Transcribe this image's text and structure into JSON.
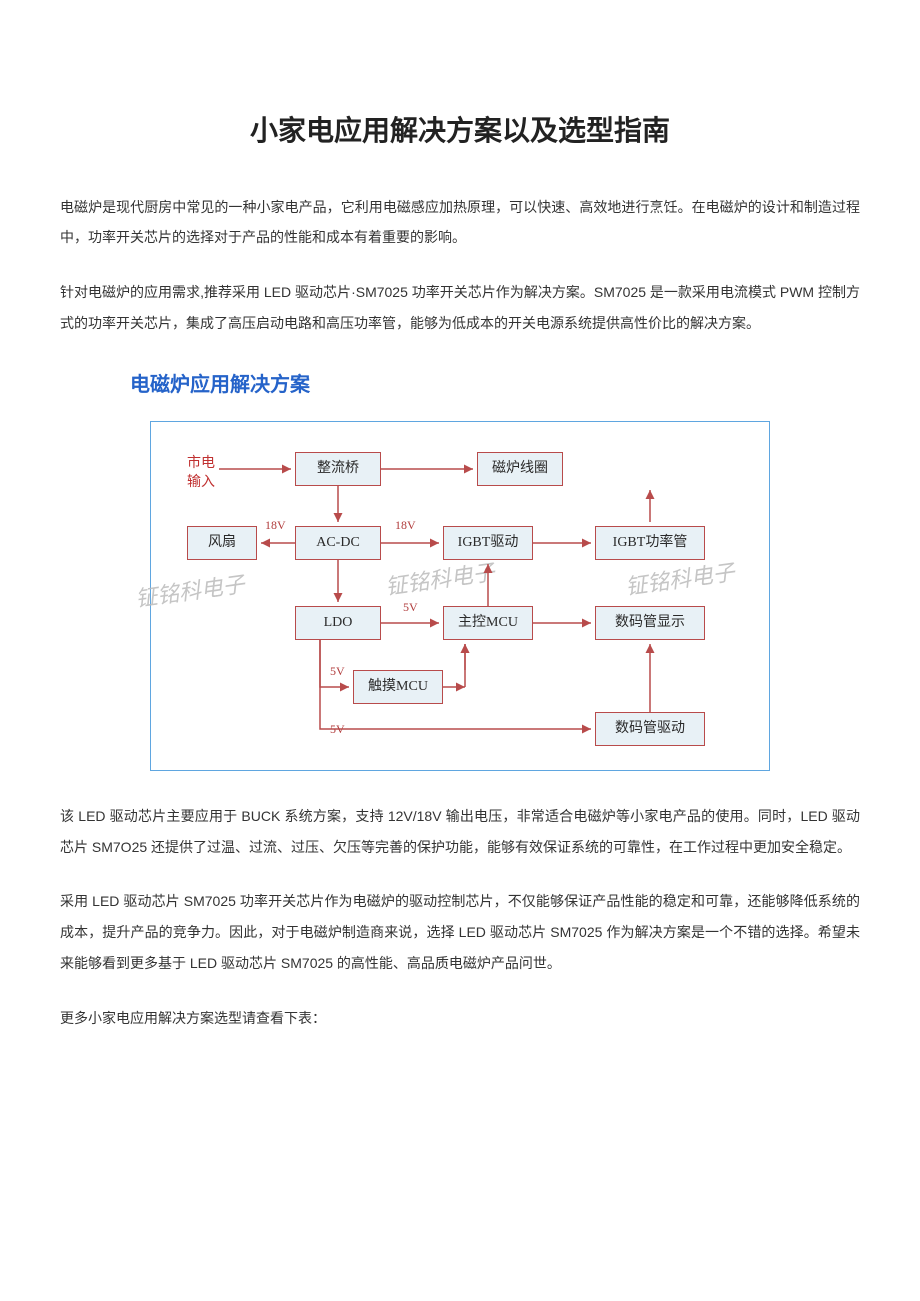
{
  "title": "小家电应用解决方案以及选型指南",
  "p1": "电磁炉是现代厨房中常见的一种小家电产品，它利用电磁感应加热原理，可以快速、高效地进行烹饪。在电磁炉的设计和制造过程中，功率开关芯片的选择对于产品的性能和成本有着重要的影响。",
  "p2": "针对电磁炉的应用需求,推荐采用 LED 驱动芯片·SM7025 功率开关芯片作为解决方案。SM7025 是一款采用电流模式 PWM 控制方式的功率开关芯片，集成了高压启动电路和高压功率管，能够为低成本的开关电源系统提供高性价比的解决方案。",
  "h2": "电磁炉应用解决方案",
  "diagram": {
    "input_label_line1": "市电",
    "input_label_line2": "输入",
    "nodes": {
      "rectifier": "整流桥",
      "coil": "磁炉线圈",
      "fan": "风扇",
      "acdc": "AC-DC",
      "igbt_drv": "IGBT驱动",
      "igbt_pwr": "IGBT功率管",
      "ldo": "LDO",
      "mcu": "主控MCU",
      "seg_disp": "数码管显示",
      "touch": "触摸MCU",
      "seg_drv": "数码管驱动"
    },
    "edge_labels": {
      "v18_left": "18V",
      "v18_right": "18V",
      "v5_a": "5V",
      "v5_b": "5V",
      "v5_c": "5V"
    },
    "watermark": "钲铭科电子"
  },
  "p3": "该 LED 驱动芯片主要应用于 BUCK 系统方案，支持 12V/18V 输出电压，非常适合电磁炉等小家电产品的使用。同时，LED 驱动芯片 SM7O25 还提供了过温、过流、过压、欠压等完善的保护功能，能够有效保证系统的可靠性，在工作过程中更加安全稳定。",
  "p4": "采用 LED 驱动芯片 SM7025 功率开关芯片作为电磁炉的驱动控制芯片，不仅能够保证产品性能的稳定和可靠，还能够降低系统的成本，提升产品的竞争力。因此，对于电磁炉制造商来说，选择 LED 驱动芯片 SM7025 作为解决方案是一个不错的选择。希望未来能够看到更多基于 LED 驱动芯片 SM7025 的高性能、高品质电磁炉产品问世。",
  "p5": "更多小家电应用解决方案选型请查看下表："
}
